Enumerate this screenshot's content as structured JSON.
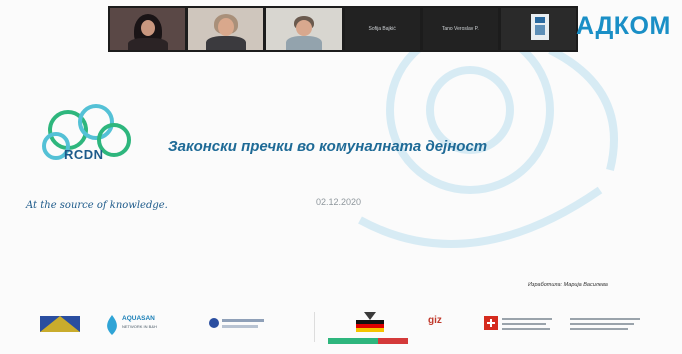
{
  "meeting": {
    "participants": [
      {
        "label": ""
      },
      {
        "label": ""
      },
      {
        "label": ""
      },
      {
        "label": "Sofija Bajkić"
      },
      {
        "label": "Tano Veroslav P."
      },
      {
        "label": ""
      }
    ]
  },
  "brand": {
    "text": "АДКОМ",
    "color": "#1a8fc6"
  },
  "slide": {
    "logo_name": "RCDN",
    "slogan": "At the source of knowledge.",
    "title": "Законски пречки во комуналната дејност",
    "date": "02.12.2020",
    "author": "Изработила: Марија Василева"
  },
  "partners": {
    "aquasan": "AQUASAN",
    "aquasan_sub": "NETWORK IN B&H",
    "gerlabel": "giz"
  },
  "colors": {
    "accent": "#1e6a96",
    "logo_green": "#2eb67d",
    "logo_blue": "#1d5a8a"
  }
}
